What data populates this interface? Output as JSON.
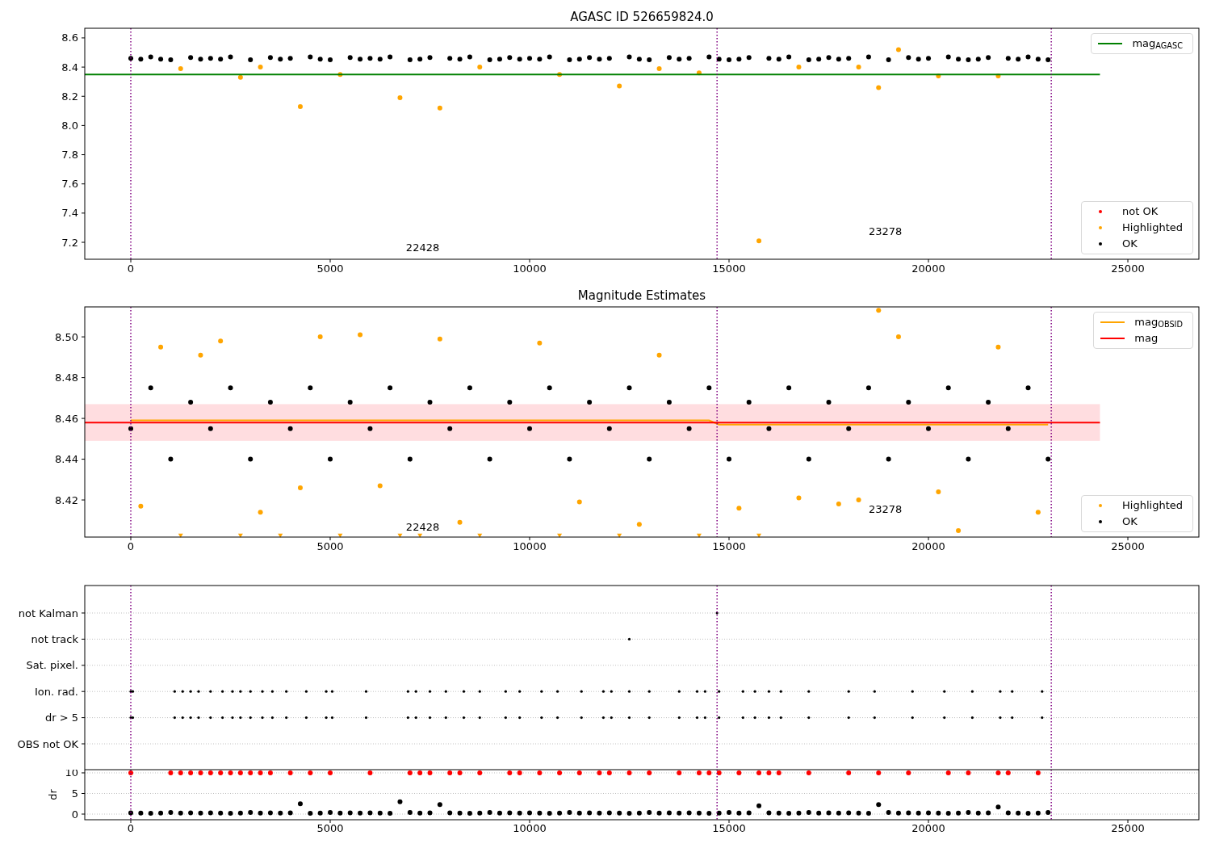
{
  "panels": [
    {
      "chart_data": {
        "type": "scatter",
        "title": "AGASC ID 526659824.0",
        "xlim": [
          -1154,
          26781
        ],
        "ylim": [
          7.084,
          8.666
        ],
        "x": [
          0,
          250,
          500,
          750,
          1000,
          1250,
          1500,
          1750,
          2000,
          2250,
          2500,
          2750,
          3000,
          3250,
          3500,
          3750,
          4000,
          4250,
          4500,
          4750,
          5000,
          5250,
          5500,
          5750,
          6000,
          6250,
          6500,
          6750,
          7000,
          7250,
          7500,
          7750,
          8000,
          8250,
          8500,
          8750,
          9000,
          9250,
          9500,
          9750,
          10000,
          10250,
          10500,
          10750,
          11000,
          11250,
          11500,
          11750,
          12000,
          12250,
          12500,
          12750,
          13000,
          13250,
          13500,
          13750,
          14000,
          14250,
          14500,
          14750,
          15000,
          15250,
          15500,
          15750,
          16000,
          16250,
          16500,
          16750,
          17000,
          17250,
          17500,
          17750,
          18000,
          18250,
          18500,
          18750,
          19000,
          19250,
          19500,
          19750,
          20000,
          20250,
          20500,
          20750,
          21000,
          21250,
          21500,
          21750,
          22000,
          22250,
          22500,
          22750,
          23000
        ],
        "xticks": [
          0,
          5000,
          10000,
          15000,
          20000,
          25000
        ],
        "yticks": [
          {
            "value": 7.2,
            "label": "7.2"
          },
          {
            "value": 7.4,
            "label": "7.4"
          },
          {
            "value": 7.6,
            "label": "7.6"
          },
          {
            "value": 7.8,
            "label": "7.8"
          },
          {
            "value": 8.0,
            "label": "8.0"
          },
          {
            "value": 8.2,
            "label": "8.2"
          },
          {
            "value": 8.4,
            "label": "8.4"
          },
          {
            "value": 8.6,
            "label": "8.6"
          }
        ],
        "series": [
          {
            "type": "scatter",
            "color": "#000000",
            "values": [
              8.46,
              8.455,
              8.47,
              8.455,
              8.45,
              null,
              8.465,
              8.455,
              8.46,
              8.455,
              8.47,
              null,
              8.45,
              null,
              8.465,
              8.455,
              8.46,
              null,
              8.47,
              8.455,
              8.45,
              null,
              8.465,
              8.455,
              8.46,
              8.455,
              8.47,
              null,
              8.45,
              8.455,
              8.465,
              null,
              8.46,
              8.455,
              8.47,
              null,
              8.45,
              8.455,
              8.465,
              8.455,
              8.46,
              8.455,
              8.47,
              null,
              8.45,
              8.455,
              8.465,
              8.455,
              8.46,
              null,
              8.47,
              8.455,
              8.45,
              null,
              8.465,
              8.455,
              8.46,
              null,
              8.47,
              8.455,
              8.45,
              8.455,
              8.465,
              null,
              8.46,
              8.455,
              8.47,
              null,
              8.45,
              8.455,
              8.465,
              8.455,
              8.46,
              null,
              8.47,
              null,
              8.45,
              null,
              8.465,
              8.455,
              8.46,
              null,
              8.47,
              8.455,
              8.45,
              8.455,
              8.465,
              null,
              8.46,
              8.455,
              8.47,
              8.455,
              8.45
            ]
          },
          {
            "type": "scatter",
            "color": "#ffa500",
            "values": [
              null,
              null,
              null,
              null,
              null,
              8.39,
              null,
              null,
              null,
              null,
              null,
              8.33,
              null,
              8.4,
              null,
              null,
              null,
              8.13,
              null,
              null,
              null,
              8.35,
              null,
              null,
              null,
              null,
              null,
              8.19,
              null,
              null,
              null,
              8.12,
              null,
              null,
              null,
              8.4,
              null,
              null,
              null,
              null,
              null,
              null,
              null,
              8.35,
              null,
              null,
              null,
              null,
              null,
              8.27,
              null,
              null,
              null,
              8.39,
              null,
              null,
              null,
              8.36,
              null,
              null,
              null,
              null,
              null,
              7.21,
              null,
              null,
              null,
              8.4,
              null,
              null,
              null,
              null,
              null,
              8.4,
              null,
              8.26,
              null,
              8.52,
              null,
              null,
              null,
              8.34,
              null,
              null,
              null,
              null,
              null,
              8.34,
              null,
              null,
              null,
              null,
              null
            ]
          }
        ],
        "ref_lines": [
          {
            "axis": "y",
            "value": 8.35,
            "color": "#008000"
          },
          {
            "axis": "x",
            "value": 0,
            "color": "#800080"
          },
          {
            "axis": "x",
            "value": 14700,
            "color": "#800080"
          },
          {
            "axis": "x",
            "value": 23080,
            "color": "#800080"
          }
        ],
        "annotations": [
          "22428",
          "23278"
        ]
      },
      "legend": [
        {
          "items": [
            {
              "label": "mag$_{AGASC}$",
              "kind": "line",
              "color": "#008000"
            }
          ]
        },
        {
          "items": [
            {
              "label": "not OK",
              "kind": "point",
              "color": "#ff0000"
            },
            {
              "label": "Highlighted",
              "kind": "point",
              "color": "#ffa500"
            },
            {
              "label": "OK",
              "kind": "point",
              "color": "#000000"
            }
          ]
        }
      ]
    },
    {
      "chart_data": {
        "type": "scatter",
        "title": "Magnitude Estimates",
        "xlim": [
          -1154,
          26781
        ],
        "ylim": [
          8.4018,
          8.5147
        ],
        "x": [
          0,
          250,
          500,
          750,
          1000,
          1250,
          1500,
          1750,
          2000,
          2250,
          2500,
          2750,
          3000,
          3250,
          3500,
          3750,
          4000,
          4250,
          4500,
          4750,
          5000,
          5250,
          5500,
          5750,
          6000,
          6250,
          6500,
          6750,
          7000,
          7250,
          7500,
          7750,
          8000,
          8250,
          8500,
          8750,
          9000,
          9250,
          9500,
          9750,
          10000,
          10250,
          10500,
          10750,
          11000,
          11250,
          11500,
          11750,
          12000,
          12250,
          12500,
          12750,
          13000,
          13250,
          13500,
          13750,
          14000,
          14250,
          14500,
          14750,
          15000,
          15250,
          15500,
          15750,
          16000,
          16250,
          16500,
          16750,
          17000,
          17250,
          17500,
          17750,
          18000,
          18250,
          18500,
          18750,
          19000,
          19250,
          19500,
          19750,
          20000,
          20250,
          20500,
          20750,
          21000,
          21250,
          21500,
          21750,
          22000,
          22250,
          22500,
          22750,
          23000
        ],
        "xticks": [
          0,
          5000,
          10000,
          15000,
          20000,
          25000
        ],
        "yticks": [
          {
            "value": 8.42,
            "label": "8.42"
          },
          {
            "value": 8.44,
            "label": "8.44"
          },
          {
            "value": 8.46,
            "label": "8.46"
          },
          {
            "value": 8.48,
            "label": "8.48"
          },
          {
            "value": 8.5,
            "label": "8.50"
          }
        ],
        "series": [
          {
            "type": "scatter",
            "color": "#000000",
            "values": [
              8.455,
              null,
              8.475,
              null,
              8.44,
              null,
              8.468,
              null,
              8.455,
              null,
              8.475,
              null,
              8.44,
              null,
              8.468,
              null,
              8.455,
              null,
              8.475,
              null,
              8.44,
              null,
              8.468,
              null,
              8.455,
              null,
              8.475,
              null,
              8.44,
              null,
              8.468,
              null,
              8.455,
              null,
              8.475,
              null,
              8.44,
              null,
              8.468,
              null,
              8.455,
              null,
              8.475,
              null,
              8.44,
              null,
              8.468,
              null,
              8.455,
              null,
              8.475,
              null,
              8.44,
              null,
              8.468,
              null,
              8.455,
              null,
              8.475,
              null,
              8.44,
              null,
              8.468,
              null,
              8.455,
              null,
              8.475,
              null,
              8.44,
              null,
              8.468,
              null,
              8.455,
              null,
              8.475,
              null,
              8.44,
              null,
              8.468,
              null,
              8.455,
              null,
              8.475,
              null,
              8.44,
              null,
              8.468,
              null,
              8.455,
              null,
              8.475,
              null,
              8.44
            ]
          },
          {
            "type": "scatter",
            "color": "#ffa500",
            "values": [
              null,
              8.417,
              null,
              8.495,
              null,
              8.4025,
              null,
              8.491,
              null,
              8.498,
              null,
              8.4025,
              null,
              8.414,
              null,
              8.4025,
              null,
              8.426,
              null,
              8.5,
              null,
              8.4025,
              null,
              8.501,
              null,
              8.427,
              null,
              8.4025,
              null,
              8.4025,
              null,
              8.499,
              null,
              8.409,
              null,
              8.4025,
              null,
              null,
              null,
              null,
              null,
              8.497,
              null,
              8.4025,
              null,
              8.419,
              null,
              null,
              null,
              8.4025,
              null,
              8.408,
              null,
              8.491,
              null,
              null,
              null,
              8.4025,
              null,
              null,
              null,
              8.416,
              null,
              8.4025,
              null,
              null,
              null,
              8.421,
              null,
              null,
              null,
              8.418,
              null,
              8.42,
              null,
              8.513,
              null,
              8.5,
              null,
              null,
              null,
              8.424,
              null,
              8.405,
              null,
              null,
              null,
              8.495,
              null,
              null,
              null,
              8.414,
              null
            ]
          },
          {
            "type": "line",
            "color": "#ffa500",
            "values": [
              8.459,
              8.459,
              8.459,
              8.459,
              8.459,
              8.459,
              8.459,
              8.459,
              8.459,
              8.459,
              8.459,
              8.459,
              8.459,
              8.459,
              8.459,
              8.459,
              8.459,
              8.459,
              8.459,
              8.459,
              8.459,
              8.459,
              8.459,
              8.459,
              8.459,
              8.459,
              8.459,
              8.459,
              8.459,
              8.459,
              8.459,
              8.459,
              8.459,
              8.459,
              8.459,
              8.459,
              8.459,
              8.459,
              8.459,
              8.459,
              8.459,
              8.459,
              8.459,
              8.459,
              8.459,
              8.459,
              8.459,
              8.459,
              8.459,
              8.459,
              8.459,
              8.459,
              8.459,
              8.459,
              8.459,
              8.459,
              8.459,
              8.459,
              8.459,
              8.457,
              8.457,
              8.457,
              8.457,
              8.457,
              8.457,
              8.457,
              8.457,
              8.457,
              8.457,
              8.457,
              8.457,
              8.457,
              8.457,
              8.457,
              8.457,
              8.457,
              8.457,
              8.457,
              8.457,
              8.457,
              8.457,
              8.457,
              8.457,
              8.457,
              8.457,
              8.457,
              8.457,
              8.457,
              8.457,
              8.457,
              8.457,
              8.457,
              8.457
            ]
          }
        ],
        "bands": [
          {
            "axis": "y",
            "from": 8.449,
            "to": 8.467,
            "color": "#ffdde0"
          }
        ],
        "ref_lines": [
          {
            "axis": "y",
            "value": 8.458,
            "color": "#ff0000"
          },
          {
            "axis": "x",
            "value": 0,
            "color": "#800080"
          },
          {
            "axis": "x",
            "value": 14700,
            "color": "#800080"
          },
          {
            "axis": "x",
            "value": 23080,
            "color": "#800080"
          }
        ],
        "annotations": [
          "22428",
          "23278"
        ]
      },
      "legend": [
        {
          "items": [
            {
              "label": "mag$_{OBSID}$",
              "kind": "line",
              "color": "#ffa500"
            },
            {
              "label": "mag",
              "kind": "line",
              "color": "#ff0000"
            }
          ]
        },
        {
          "items": [
            {
              "label": "Highlighted",
              "kind": "point",
              "color": "#ffa500"
            },
            {
              "label": "OK",
              "kind": "point",
              "color": "#000000"
            }
          ]
        }
      ]
    },
    {
      "row_labels": [
        "not Kalman",
        "not track",
        "Sat. pixel.",
        "Ion. rad.",
        "dr > 5",
        "OBS not OK"
      ]
    },
    {
      "chart_data": {
        "type": "scatter",
        "ylabel": "dr",
        "grid": true,
        "xlim": [
          -1154,
          26781
        ],
        "ylim": [
          -1.37,
          10.78
        ],
        "x": [
          0,
          250,
          500,
          750,
          1000,
          1250,
          1500,
          1750,
          2000,
          2250,
          2500,
          2750,
          3000,
          3250,
          3500,
          3750,
          4000,
          4250,
          4500,
          4750,
          5000,
          5250,
          5500,
          5750,
          6000,
          6250,
          6500,
          6750,
          7000,
          7250,
          7500,
          7750,
          8000,
          8250,
          8500,
          8750,
          9000,
          9250,
          9500,
          9750,
          10000,
          10250,
          10500,
          10750,
          11000,
          11250,
          11500,
          11750,
          12000,
          12250,
          12500,
          12750,
          13000,
          13250,
          13500,
          13750,
          14000,
          14250,
          14500,
          14750,
          15000,
          15250,
          15500,
          15750,
          16000,
          16250,
          16500,
          16750,
          17000,
          17250,
          17500,
          17750,
          18000,
          18250,
          18500,
          18750,
          19000,
          19250,
          19500,
          19750,
          20000,
          20250,
          20500,
          20750,
          21000,
          21250,
          21500,
          21750,
          22000,
          22250,
          22500,
          22750,
          23000
        ],
        "xticks": [
          0,
          5000,
          10000,
          15000,
          20000,
          25000
        ],
        "yticks": [
          {
            "value": 0,
            "label": "0"
          },
          {
            "value": 5,
            "label": "5"
          },
          {
            "value": 10,
            "label": "10"
          }
        ],
        "series": [
          {
            "type": "scatter",
            "color": "#000000",
            "values": [
              0.3,
              0.25,
              0.2,
              0.25,
              0.4,
              0.25,
              0.3,
              0.25,
              0.3,
              0.25,
              0.2,
              0.25,
              0.4,
              0.25,
              0.3,
              0.25,
              0.3,
              2.5,
              0.2,
              0.25,
              0.4,
              0.25,
              0.3,
              0.25,
              0.3,
              0.25,
              0.2,
              3,
              0.4,
              0.25,
              0.3,
              2.3,
              0.3,
              0.25,
              0.2,
              0.25,
              0.4,
              0.25,
              0.3,
              0.25,
              0.3,
              0.25,
              0.2,
              0.25,
              0.4,
              0.25,
              0.3,
              0.25,
              0.3,
              0.25,
              0.2,
              0.25,
              0.4,
              0.25,
              0.3,
              0.25,
              0.3,
              0.25,
              0.2,
              0.25,
              0.4,
              0.25,
              0.3,
              2,
              0.3,
              0.25,
              0.2,
              0.25,
              0.4,
              0.25,
              0.3,
              0.25,
              0.3,
              0.25,
              0.2,
              2.3,
              0.4,
              0.25,
              0.3,
              0.25,
              0.3,
              0.25,
              0.2,
              0.25,
              0.4,
              0.25,
              0.3,
              1.7,
              0.3,
              0.25,
              0.2,
              0.25,
              0.4
            ]
          },
          {
            "type": "scatter",
            "color": "#ff0000",
            "values": [
              10,
              null,
              null,
              null,
              10,
              10,
              10,
              10,
              10,
              10,
              10,
              10,
              10,
              10,
              10,
              null,
              10,
              null,
              10,
              null,
              10,
              null,
              null,
              null,
              10,
              null,
              null,
              null,
              10,
              10,
              10,
              null,
              10,
              10,
              null,
              10,
              null,
              null,
              10,
              10,
              null,
              10,
              null,
              10,
              null,
              10,
              null,
              10,
              10,
              null,
              10,
              null,
              10,
              null,
              null,
              10,
              null,
              10,
              10,
              10,
              null,
              10,
              null,
              10,
              10,
              10,
              null,
              null,
              10,
              null,
              null,
              null,
              10,
              null,
              null,
              10,
              null,
              null,
              10,
              null,
              null,
              null,
              10,
              null,
              10,
              null,
              null,
              10,
              10,
              null,
              null,
              10,
              null
            ]
          }
        ],
        "ref_lines": [
          {
            "axis": "x",
            "value": 0,
            "color": "#800080"
          },
          {
            "axis": "x",
            "value": 14700,
            "color": "#800080"
          },
          {
            "axis": "x",
            "value": 23080,
            "color": "#800080"
          }
        ]
      }
    }
  ]
}
